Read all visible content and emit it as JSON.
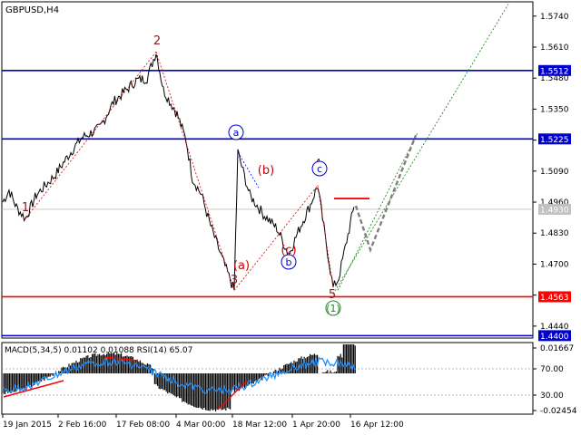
{
  "title": "GBPUSD,H4",
  "chart_data": [
    {
      "type": "line",
      "title": "GBPUSD,H4",
      "price_axis": {
        "ticks": [
          "1.5740",
          "1.5610",
          "1.5480",
          "1.5350",
          "1.5220",
          "1.5090",
          "1.4960",
          "1.4830",
          "1.4700",
          "1.4570",
          "1.4440"
        ],
        "ylim": [
          1.439,
          1.58
        ]
      },
      "horizontal_levels": [
        {
          "value": 1.5512,
          "label": "1.5512",
          "color": "#0000cc"
        },
        {
          "value": 1.5225,
          "label": "1.5225",
          "color": "#0000cc"
        },
        {
          "value": 1.4563,
          "label": "1.4563",
          "color": "#ff0000"
        },
        {
          "value": 1.44,
          "label": "1.4400",
          "color": "#0000cc"
        }
      ],
      "current_price": {
        "value": 1.493,
        "label": "1.4930"
      },
      "wave_labels": [
        {
          "text": "1",
          "color": "#8b1a1a"
        },
        {
          "text": "2",
          "color": "#8b1a1a"
        },
        {
          "text": "3",
          "color": "#8b1a1a"
        },
        {
          "text": "4",
          "color": "#8b1a1a"
        },
        {
          "text": "5",
          "color": "#8b1a1a"
        },
        {
          "text": "(a)",
          "color": "#cc0000"
        },
        {
          "text": "(b)",
          "color": "#cc0000"
        },
        {
          "text": "(c)",
          "color": "#cc0000"
        },
        {
          "text": "a",
          "color": "#0000cc",
          "circled": true
        },
        {
          "text": "b",
          "color": "#0000cc",
          "circled": true
        },
        {
          "text": "c",
          "color": "#0000cc",
          "circled": true
        },
        {
          "text": "(1)",
          "color": "#228b22",
          "circled": true
        }
      ],
      "x_tick_labels": [
        "19 Jan 2015",
        "2 Feb 16:00",
        "17 Feb 08:00",
        "4 Mar 00:00",
        "18 Mar 12:00",
        "1 Apr 20:00",
        "16 Apr 12:00"
      ],
      "colors": {
        "price": "#000000",
        "projection": "#808080",
        "trend_channel": "#228b22",
        "wave_link": "#cc0000"
      }
    },
    {
      "type": "histogram",
      "title": "MACD(5,34,5) 0.01102 0.01088 RSI(14) 65.07",
      "macd_axis": {
        "ticks": [
          "0.01667",
          "-0.02454"
        ]
      },
      "rsi_axis": {
        "ticks": [
          "70.00",
          "30.00"
        ]
      },
      "colors": {
        "histogram": "#000000",
        "rsi": "#1e90ff",
        "trendline": "#ff0000"
      }
    }
  ]
}
